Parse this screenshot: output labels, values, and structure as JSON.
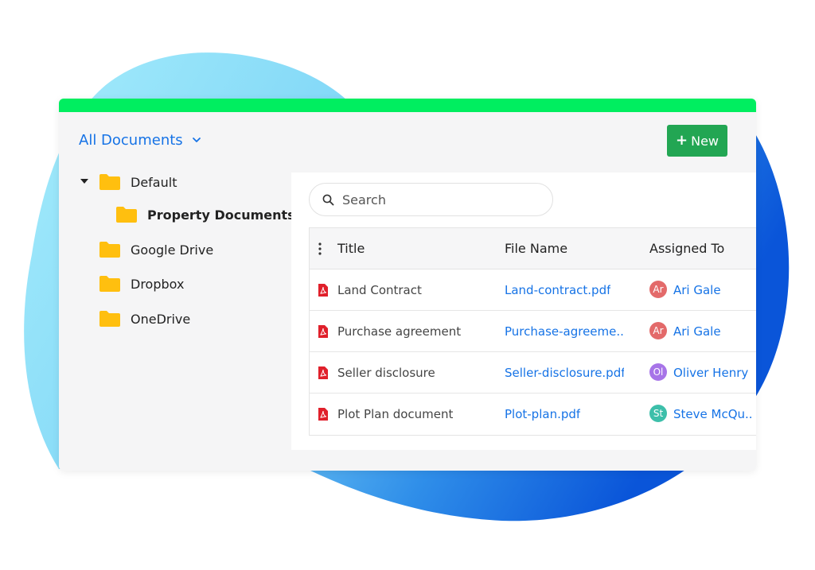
{
  "colors": {
    "accent_bar": "#00ee60",
    "primary_link": "#1673e6",
    "new_button": "#22a653",
    "folder": "#ffbf0f",
    "pdf": "#e0202b",
    "blob_light": "#a5ecfb",
    "blob_dark": "#0a55d9"
  },
  "header": {
    "view_label": "All Documents",
    "view_icon": "chevron-down-icon",
    "new_button_label": "New",
    "new_button_icon": "plus-icon"
  },
  "tree": {
    "items": [
      {
        "label": "Default",
        "icon": "folder-icon",
        "expanded": true
      },
      {
        "label": "Property Documents",
        "icon": "folder-icon",
        "selected": true
      },
      {
        "label": "Google Drive",
        "icon": "folder-icon"
      },
      {
        "label": "Dropbox",
        "icon": "folder-icon"
      },
      {
        "label": "OneDrive",
        "icon": "folder-icon"
      }
    ]
  },
  "search": {
    "placeholder": "Search",
    "icon": "search-icon"
  },
  "table": {
    "columns": [
      "Title",
      "File Name",
      "Assigned To"
    ],
    "rows": [
      {
        "title": "Land Contract",
        "file": "Land-contract.pdf",
        "initials": "Ar",
        "assignee": "Ari Gale",
        "avatar_color": "#e36a6a"
      },
      {
        "title": "Purchase agreement",
        "file": "Purchase-agreeme..",
        "initials": "Ar",
        "assignee": "Ari Gale",
        "avatar_color": "#e36a6a"
      },
      {
        "title": "Seller disclosure",
        "file": "Seller-disclosure.pdf",
        "initials": "Ol",
        "assignee": "Oliver Henry",
        "avatar_color": "#a774e8"
      },
      {
        "title": "Plot Plan document",
        "file": "Plot-plan.pdf",
        "initials": "St",
        "assignee": "Steve McQu...",
        "avatar_color": "#3dbfaa"
      }
    ]
  }
}
